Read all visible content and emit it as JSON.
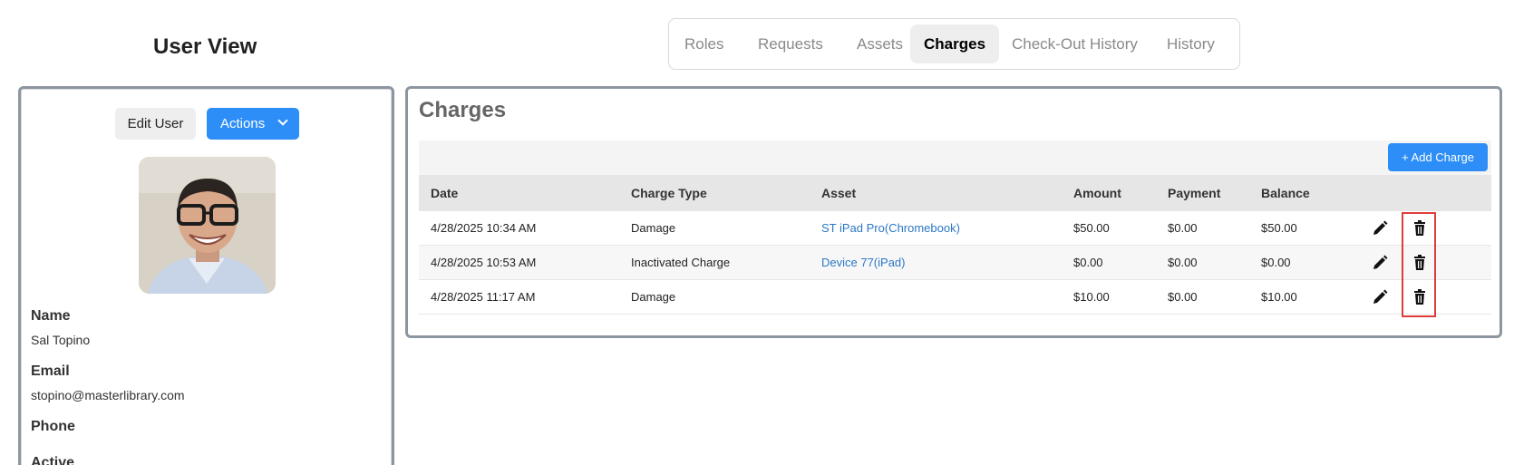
{
  "page": {
    "title": "User View"
  },
  "tabs": [
    {
      "label": "Roles",
      "active": false
    },
    {
      "label": "Requests",
      "active": false
    },
    {
      "label": "Assets",
      "active": false
    },
    {
      "label": "Charges",
      "active": true
    },
    {
      "label": "Check-Out History",
      "active": false
    },
    {
      "label": "History",
      "active": false
    }
  ],
  "user_panel": {
    "edit_label": "Edit User",
    "actions_label": "Actions",
    "avatar_icon": "user-photo",
    "fields": [
      {
        "label": "Name",
        "value": "Sal Topino"
      },
      {
        "label": "Email",
        "value": "stopino@masterlibrary.com"
      },
      {
        "label": "Phone",
        "value": ""
      },
      {
        "label": "Active",
        "value": ""
      }
    ]
  },
  "charges": {
    "title": "Charges",
    "add_label": "+ Add Charge",
    "columns": [
      "Date",
      "Charge Type",
      "Asset",
      "Amount",
      "Payment",
      "Balance"
    ],
    "rows": [
      {
        "date": "4/28/2025 10:34 AM",
        "type": "Damage",
        "asset": "ST iPad Pro(Chromebook)",
        "amount": "$50.00",
        "payment": "$0.00",
        "balance": "$50.00"
      },
      {
        "date": "4/28/2025 10:53 AM",
        "type": "Inactivated Charge",
        "asset": "Device 77(iPad)",
        "amount": "$0.00",
        "payment": "$0.00",
        "balance": "$0.00"
      },
      {
        "date": "4/28/2025 11:17 AM",
        "type": "Damage",
        "asset": "",
        "amount": "$10.00",
        "payment": "$0.00",
        "balance": "$10.00"
      }
    ],
    "row_icons": {
      "edit": "pencil-icon",
      "delete": "trash-icon"
    }
  },
  "colors": {
    "primary": "#2d8ef7",
    "link": "#2b78c5",
    "highlight": "#e03c3c",
    "panel_border": "#8d96a0"
  }
}
